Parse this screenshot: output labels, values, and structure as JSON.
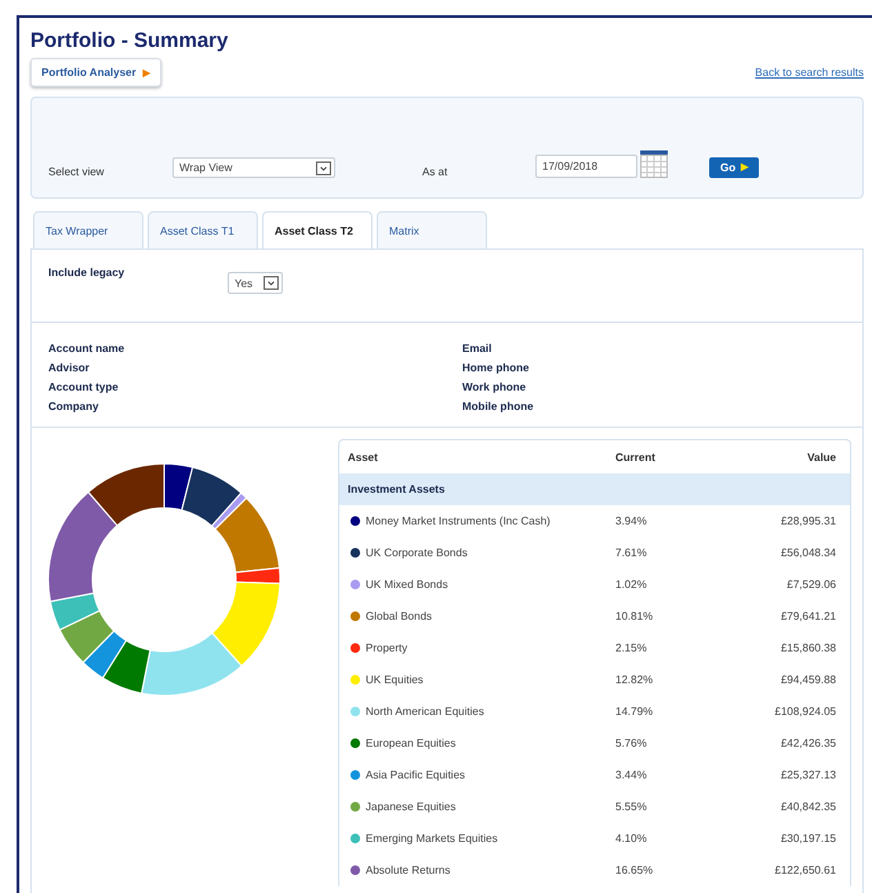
{
  "title": "Portfolio - Summary",
  "analyser_button": {
    "label": "Portfolio Analyser",
    "icon": "▶"
  },
  "back_link": "Back to search results",
  "filter": {
    "select_view_label": "Select view",
    "select_view_value": "Wrap View",
    "as_at_label": "As at",
    "date_value": "17/09/2018",
    "go_button": "Go",
    "go_icon": "▶"
  },
  "tabs": [
    {
      "label": "Tax Wrapper",
      "selected": false
    },
    {
      "label": "Asset Class T1",
      "selected": false
    },
    {
      "label": "Asset Class T2",
      "selected": true
    },
    {
      "label": "Matrix",
      "selected": false
    }
  ],
  "include_legacy": {
    "label": "Include legacy",
    "value": "Yes"
  },
  "account_fields": [
    [
      "Account name",
      "Advisor",
      "Account type",
      "Company"
    ],
    [
      "Email",
      "Home phone",
      "Work phone",
      "Mobile phone"
    ]
  ],
  "table": {
    "columns": [
      "Asset",
      "Current",
      "Value"
    ],
    "group": "Investment Assets",
    "rows": [
      {
        "asset": "Money Market Instruments (Inc Cash)",
        "current": "3.94%",
        "value": "£28,995.31",
        "color": "#000080"
      },
      {
        "asset": "UK Corporate Bonds",
        "current": "7.61%",
        "value": "£56,048.34",
        "color": "#17325c"
      },
      {
        "asset": "UK Mixed Bonds",
        "current": "1.02%",
        "value": "£7,529.06",
        "color": "#a99cf0"
      },
      {
        "asset": "Global Bonds",
        "current": "10.81%",
        "value": "£79,641.21",
        "color": "#c07800"
      },
      {
        "asset": "Property",
        "current": "2.15%",
        "value": "£15,860.38",
        "color": "#ff2a10"
      },
      {
        "asset": "UK Equities",
        "current": "12.82%",
        "value": "£94,459.88",
        "color": "#ffee00"
      },
      {
        "asset": "North American Equities",
        "current": "14.79%",
        "value": "£108,924.05",
        "color": "#8fe3ee"
      },
      {
        "asset": "European Equities",
        "current": "5.76%",
        "value": "£42,426.35",
        "color": "#007a00"
      },
      {
        "asset": "Asia Pacific Equities",
        "current": "3.44%",
        "value": "£25,327.13",
        "color": "#1494dd"
      },
      {
        "asset": "Japanese Equities",
        "current": "5.55%",
        "value": "£40,842.35",
        "color": "#72a843"
      },
      {
        "asset": "Emerging Markets Equities",
        "current": "4.10%",
        "value": "£30,197.15",
        "color": "#3cc0b8"
      },
      {
        "asset": "Absolute Returns",
        "current": "16.65%",
        "value": "£122,650.61",
        "color": "#7f5aa8"
      }
    ]
  }
}
